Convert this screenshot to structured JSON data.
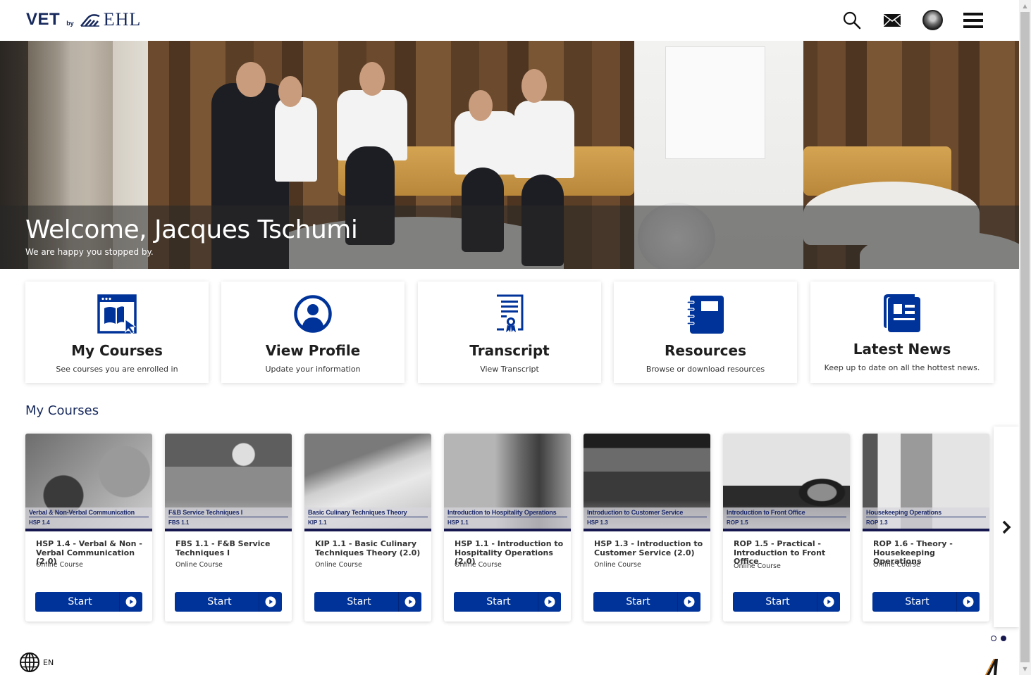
{
  "header": {
    "logo": {
      "vet": "VET",
      "by": "by",
      "ehl": "EHL"
    },
    "icons": [
      "search-icon",
      "mail-icon",
      "avatar",
      "hamburger-menu-icon"
    ]
  },
  "hero": {
    "welcome": "Welcome, Jacques Tschumi",
    "subtitle": "We are happy you stopped by."
  },
  "quick_links": [
    {
      "title": "My Courses",
      "subtitle": "See courses you are enrolled in",
      "icon": "course-book-icon"
    },
    {
      "title": "View Profile",
      "subtitle": "Update your information",
      "icon": "profile-icon"
    },
    {
      "title": "Transcript",
      "subtitle": "View Transcript",
      "icon": "transcript-certificate-icon"
    },
    {
      "title": "Resources",
      "subtitle": "Browse or download resources",
      "icon": "notebook-icon"
    },
    {
      "title": "Latest News",
      "subtitle": "Keep up to date on all the hottest news.",
      "icon": "newspaper-icon"
    }
  ],
  "my_courses": {
    "title": "My Courses",
    "items": [
      {
        "thumb_title": "Verbal & Non-Verbal Communication",
        "thumb_code": "HSP 1.4",
        "title": "HSP 1.4 - Verbal & Non - Verbal Communication (2.0)",
        "type": "Online Course",
        "button": "Start"
      },
      {
        "thumb_title": "F&B Service Techniques I",
        "thumb_code": "FBS 1.1",
        "title": "FBS 1.1 - F&B Service Techniques I",
        "type": "Online Course",
        "button": "Start"
      },
      {
        "thumb_title": "Basic Culinary Techniques Theory",
        "thumb_code": "KIP 1.1",
        "title": "KIP 1.1 - Basic Culinary Techniques Theory (2.0)",
        "type": "Online Course",
        "button": "Start"
      },
      {
        "thumb_title": "Introduction to Hospitality Operations",
        "thumb_code": "HSP 1.1",
        "title": "HSP 1.1 - Introduction to Hospitality Operations (2.0)",
        "type": "Online Course",
        "button": "Start"
      },
      {
        "thumb_title": "Introduction to Customer Service",
        "thumb_code": "HSP 1.3",
        "title": "HSP 1.3 - Introduction to Customer Service (2.0)",
        "type": "Online Course",
        "button": "Start"
      },
      {
        "thumb_title": "Introduction to Front Office",
        "thumb_code": "ROP 1.5",
        "title": "ROP 1.5 - Practical - Introduction to Front Office",
        "type": "Online Course",
        "button": "Start"
      },
      {
        "thumb_title": "Housekeeping Operations",
        "thumb_code": "ROP 1.3",
        "title": "ROP 1.6 - Theory - Housekeeping Operations",
        "type": "Online Course",
        "button": "Start"
      }
    ],
    "pagination": {
      "pages": 2,
      "current": 2
    }
  },
  "footer": {
    "language": "EN"
  },
  "colors": {
    "brand_navy": "#17295c",
    "button_blue": "#003399",
    "bar_dark": "#17174f"
  }
}
